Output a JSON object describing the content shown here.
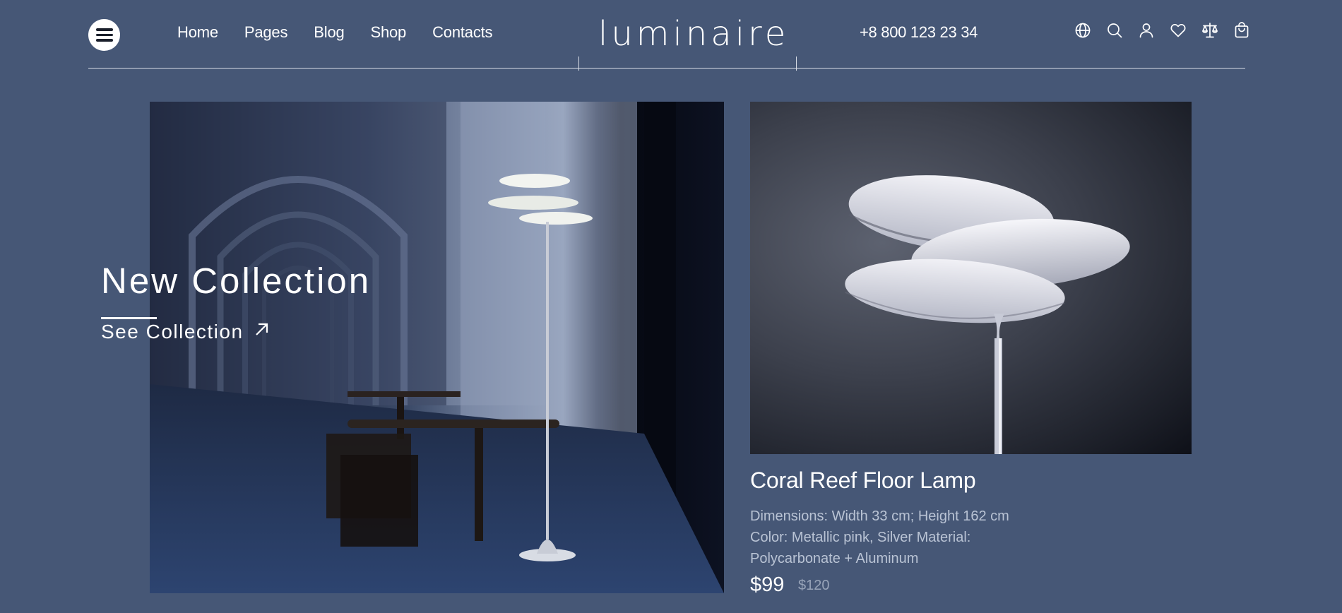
{
  "header": {
    "menu_icon": "hamburger-icon",
    "nav": [
      "Home",
      "Pages",
      "Blog",
      "Shop",
      "Contacts"
    ],
    "logo": "luminaire",
    "phone": "+8 800 123 23 34",
    "icons": [
      "globe-icon",
      "search-icon",
      "user-icon",
      "heart-icon",
      "compare-scales-icon",
      "shopping-bag-icon"
    ]
  },
  "hero": {
    "title": "New Collection",
    "link_label": "See Collection",
    "link_icon": "arrow-up-right-icon"
  },
  "product": {
    "name": "Coral Reef Floor Lamp",
    "description": "Dimensions: Width 33 cm; Height 162 cm Color: Metallic pink, Silver Material: Polycarbonate + Aluminum",
    "price": "$99",
    "old_price": "$120"
  },
  "colors": {
    "background": "#465776",
    "text": "#ffffff",
    "muted_text": "#b9c3d4"
  }
}
